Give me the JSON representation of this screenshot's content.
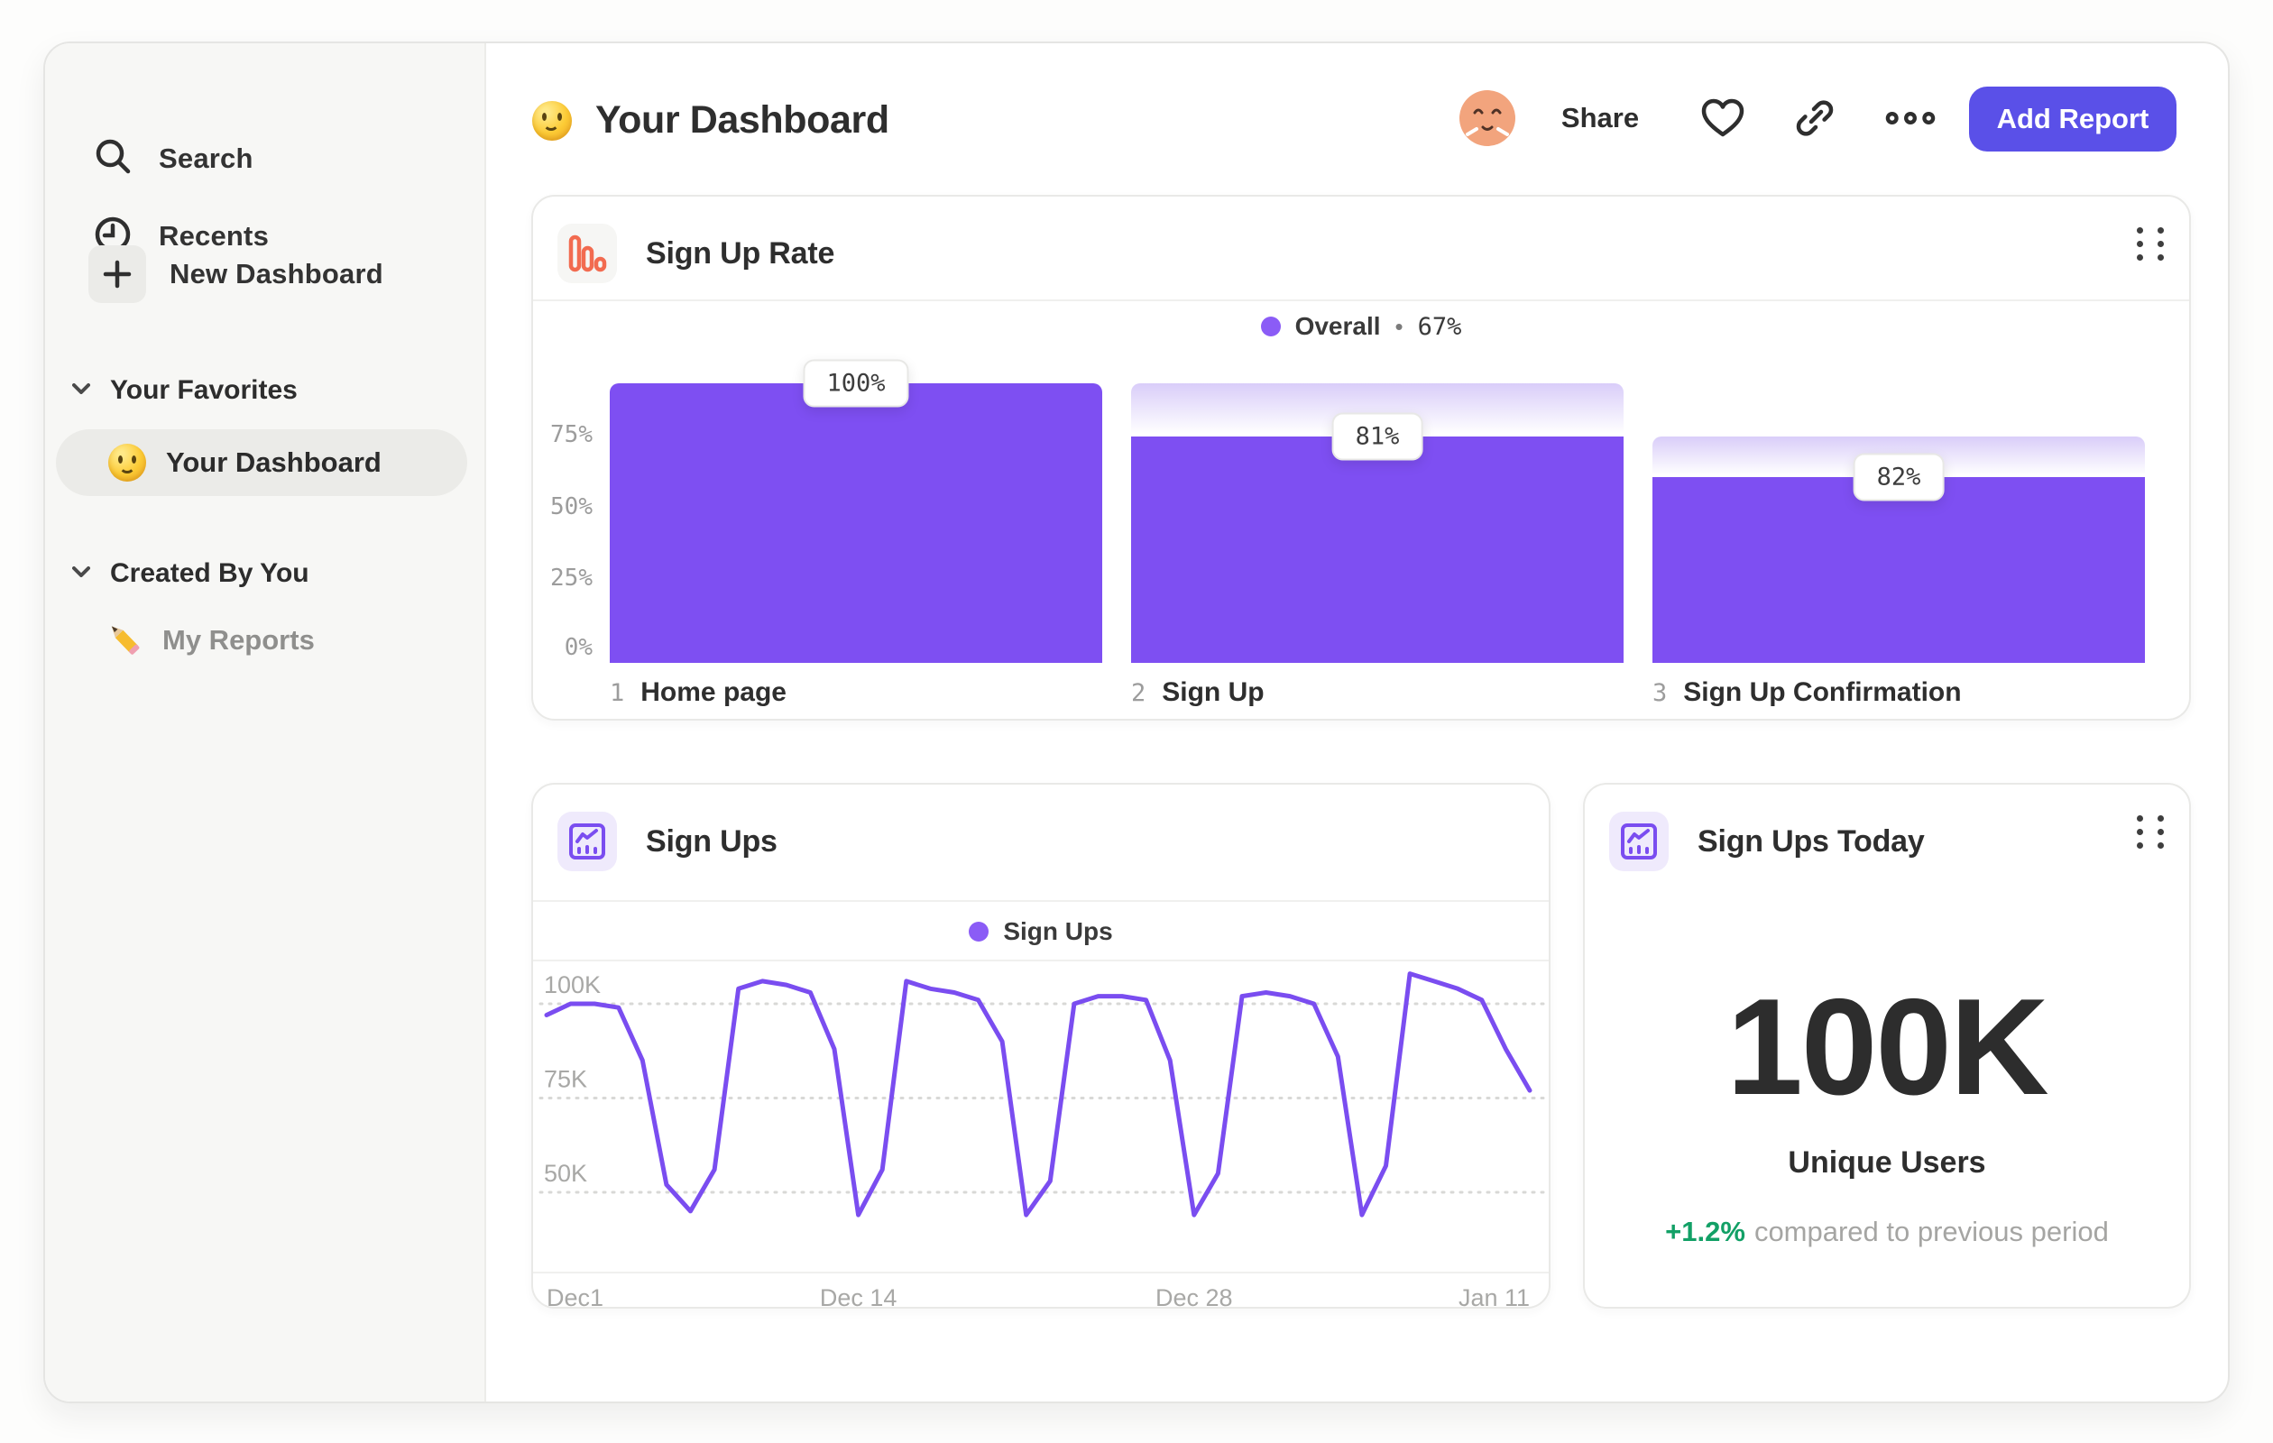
{
  "colors": {
    "accent": "#7a4df0",
    "bar": "#7e4ff2",
    "dot": "#8b5cf6",
    "button": "#5a50e8",
    "orange": "#f26b50",
    "green": "#12a066"
  },
  "sidebar": {
    "items": [
      {
        "icon": "search-icon",
        "label": "Search"
      },
      {
        "icon": "clock-icon",
        "label": "Recents"
      },
      {
        "icon": "plus-icon",
        "label": "New Dashboard"
      }
    ],
    "sections": [
      {
        "label": "Your Favorites",
        "item": {
          "icon": "smiley-emoji",
          "label": "Your Dashboard"
        }
      },
      {
        "label": "Created By You",
        "item": {
          "icon": "pencil-emoji",
          "label": "My Reports"
        }
      }
    ]
  },
  "header": {
    "title_emoji": "smiley-emoji",
    "title": "Your Dashboard",
    "share_label": "Share",
    "add_report_label": "Add Report"
  },
  "cards": {
    "funnel": {
      "icon": "funnel-bars-icon",
      "title": "Sign Up Rate",
      "legend": {
        "series": "Overall",
        "separator": "•",
        "value": "67%"
      },
      "yticks": [
        "75%",
        "50%",
        "25%",
        "0%"
      ],
      "steps": [
        {
          "index": "1",
          "label": "Home page",
          "value_label": "100%"
        },
        {
          "index": "2",
          "label": "Sign Up",
          "value_label": "81%"
        },
        {
          "index": "3",
          "label": "Sign Up Confirmation",
          "value_label": "82%"
        }
      ]
    },
    "line": {
      "icon": "trend-chart-icon",
      "title": "Sign Ups",
      "legend": {
        "series": "Sign Ups"
      }
    },
    "stat": {
      "icon": "trend-chart-icon",
      "title": "Sign Ups Today",
      "value": "100K",
      "sub": "Unique Users",
      "delta": "+1.2%",
      "delta_note": "compared to previous period"
    }
  },
  "chart_data": [
    {
      "type": "bar",
      "title": "Sign Up Rate",
      "subtype": "funnel",
      "categories": [
        "Home page",
        "Sign Up",
        "Sign Up Confirmation"
      ],
      "step_numbers": [
        1,
        2,
        3
      ],
      "values": [
        100,
        81,
        82
      ],
      "cumulative": [
        100,
        81,
        66.4
      ],
      "data_labels": [
        "100%",
        "81%",
        "82%"
      ],
      "legend": [
        "Overall"
      ],
      "overall_conversion": "67%",
      "ylabel": "",
      "xlabel": "",
      "ylim": [
        0,
        100
      ],
      "ytick_values": [
        0,
        25,
        50,
        75
      ],
      "grid": false,
      "legend_position": "top-center"
    },
    {
      "type": "line",
      "title": "Sign Ups",
      "series": [
        {
          "name": "Sign Ups",
          "unit": "K",
          "values": [
            97,
            100,
            100,
            99,
            85,
            52,
            45,
            56,
            104,
            106,
            105,
            103,
            88,
            44,
            56,
            106,
            104,
            103,
            101,
            90,
            44,
            53,
            100,
            102,
            102,
            101,
            85,
            44,
            55,
            102,
            103,
            102,
            100,
            86,
            44,
            57,
            108,
            106,
            104,
            101,
            88,
            77
          ]
        }
      ],
      "x_start": "Dec 1",
      "x_end": "Jan 11",
      "xticks": [
        {
          "label": "Dec1",
          "index": 0,
          "align": "left"
        },
        {
          "label": "Dec 14",
          "index": 13,
          "align": "center"
        },
        {
          "label": "Dec 28",
          "index": 27,
          "align": "center"
        },
        {
          "label": "Jan 11",
          "index": 41,
          "align": "right"
        }
      ],
      "yticks": [
        {
          "label": "100K",
          "value": 100
        },
        {
          "label": "75K",
          "value": 75
        },
        {
          "label": "50K",
          "value": 50
        }
      ],
      "ylim": [
        40,
        112
      ],
      "grid": "dotted-horizontal",
      "legend_position": "top-center"
    }
  ]
}
